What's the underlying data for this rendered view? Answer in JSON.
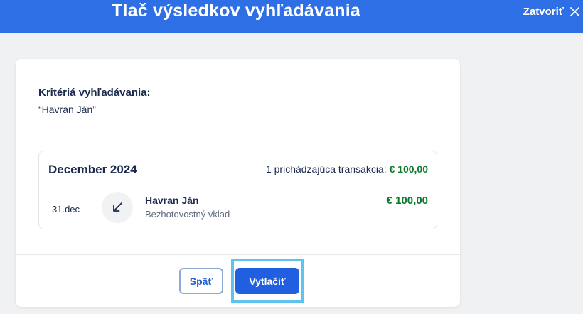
{
  "header": {
    "title": "Tlač výsledkov vyhľadávania",
    "close_label": "Zatvoriť",
    "close_icon": "close-icon",
    "background": "#2f6fe6"
  },
  "criteria": {
    "label": "Kritériá vyhľadávania:",
    "value": "“Havran Ján”"
  },
  "month": {
    "title": "December 2024",
    "summary_label": "1 prichádzajúca transakcia:",
    "summary_amount": "€ 100,00"
  },
  "transactions": [
    {
      "date": "31.dec",
      "icon": "incoming-arrow-icon",
      "name": "Havran Ján",
      "description": "Bezhotovostný vklad",
      "amount": "€ 100,00"
    }
  ],
  "actions": {
    "back_label": "Späť",
    "print_label": "Vytlačiť"
  },
  "colors": {
    "accent": "#1f5fe0",
    "positive_amount": "#0d7a2e",
    "focus_ring": "#5fc3f0"
  }
}
